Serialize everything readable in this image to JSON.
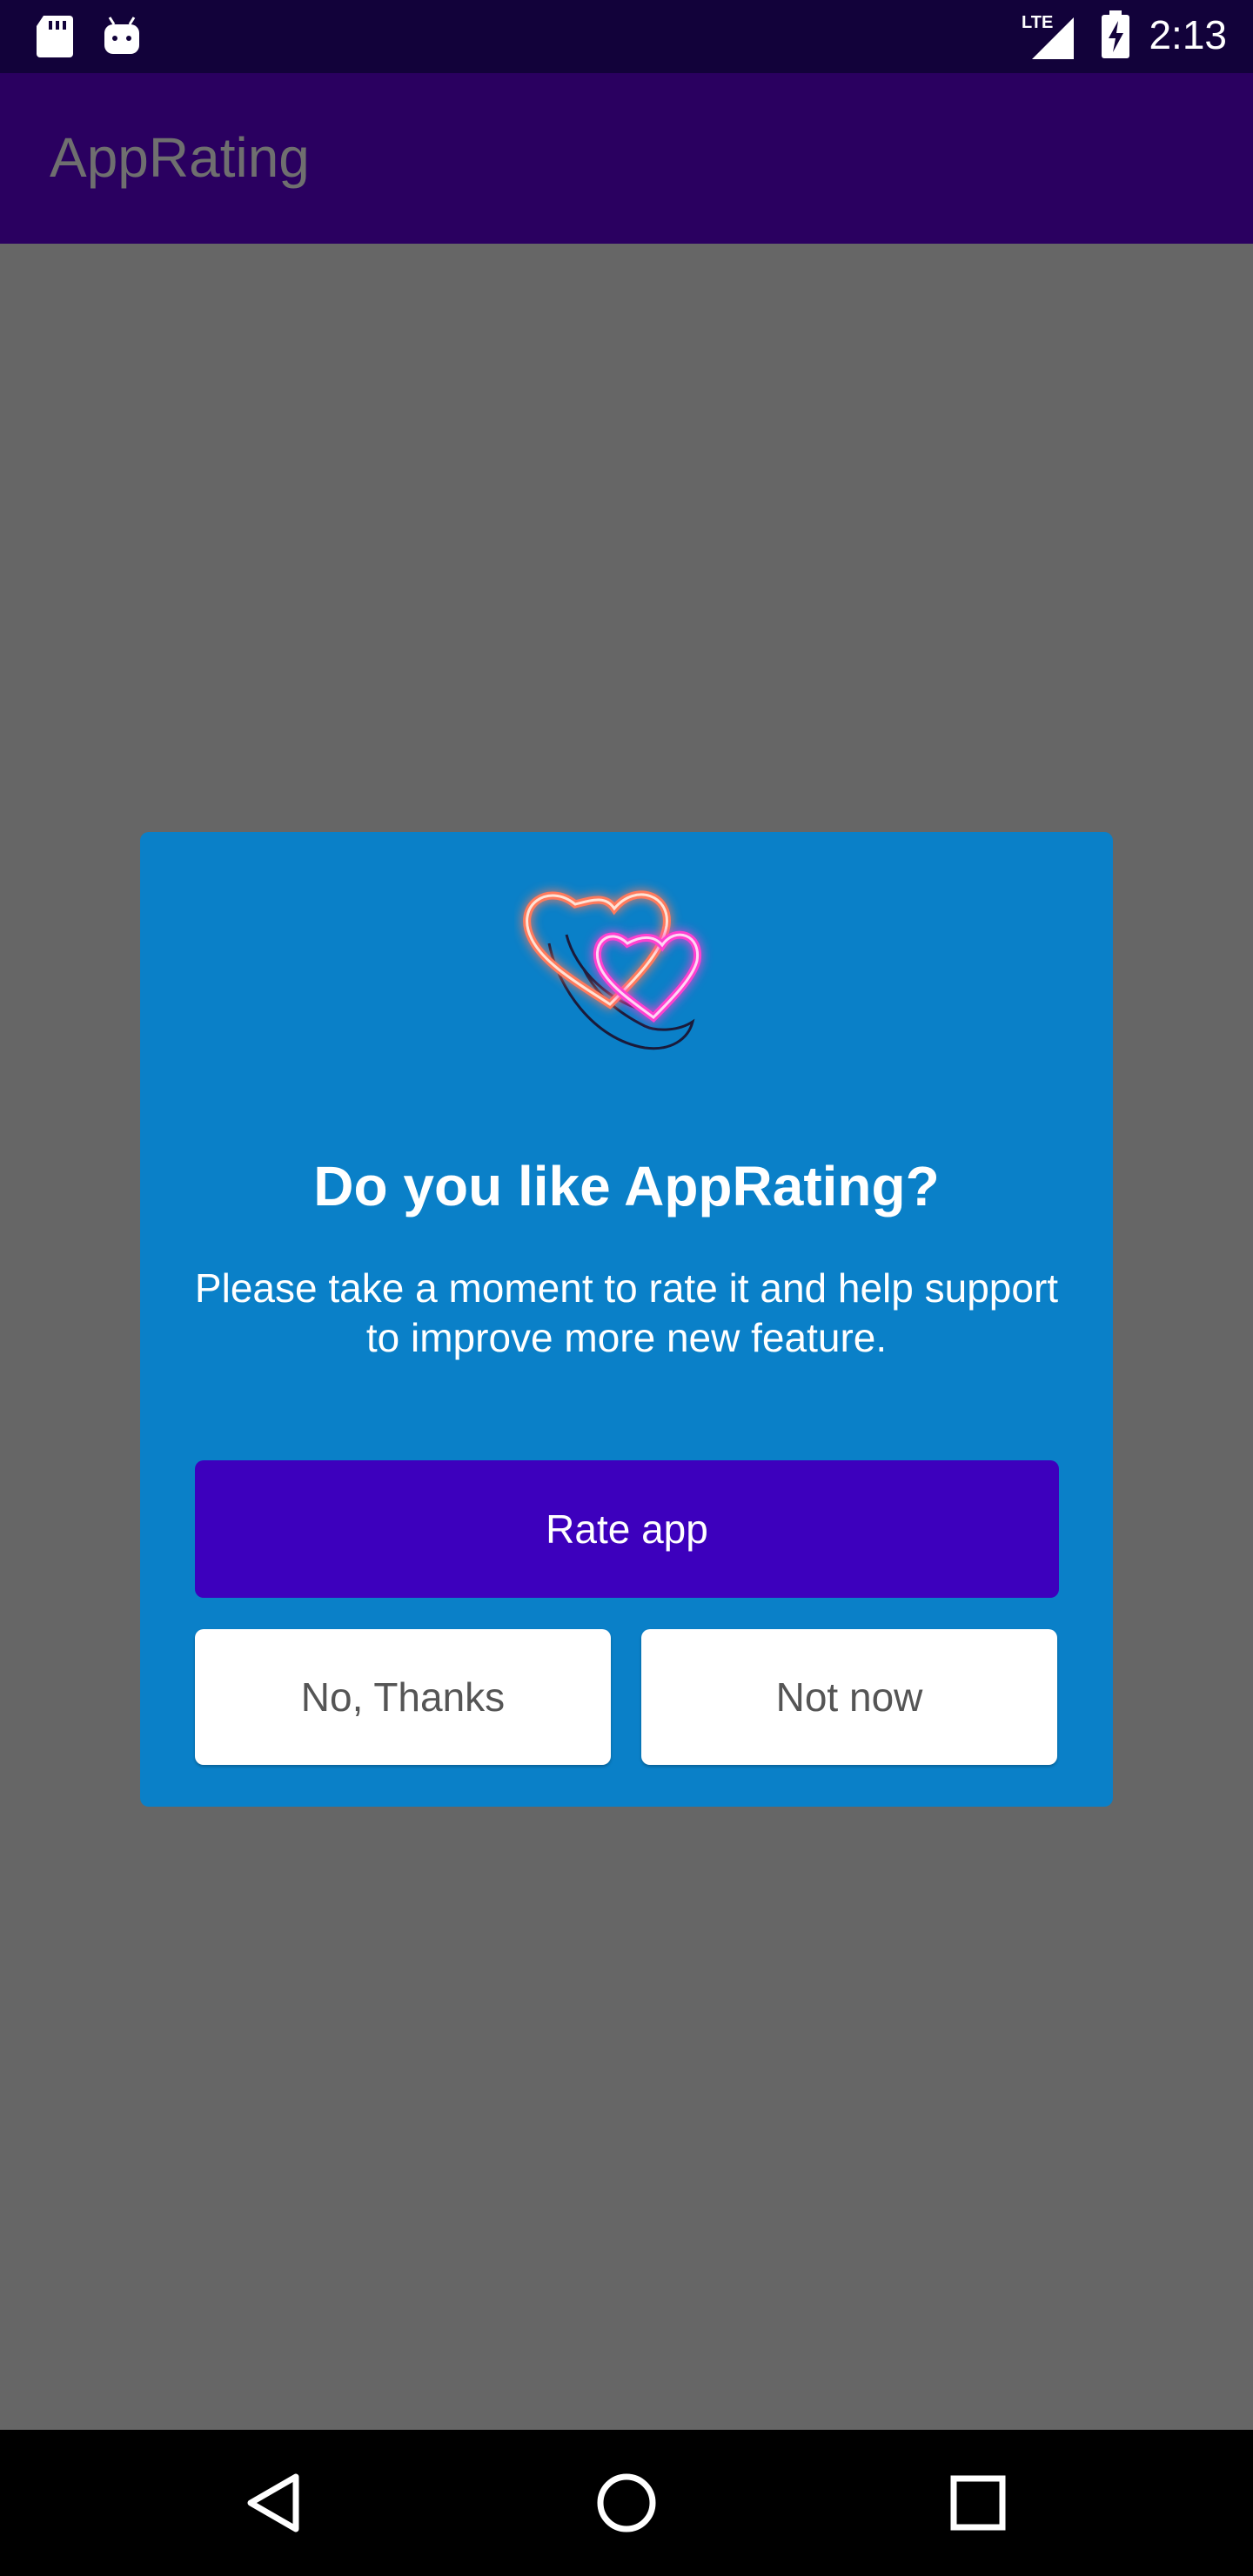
{
  "status_bar": {
    "time": "2:13",
    "network_label": "LTE",
    "icons": [
      "sd-card-icon",
      "android-icon",
      "signal-icon",
      "battery-charging-icon"
    ]
  },
  "app_bar": {
    "title": "AppRating"
  },
  "dialog": {
    "icon": "neon-hearts-icon",
    "title": "Do you like AppRating?",
    "message": "Please take a moment to rate it and help support to improve more new feature.",
    "primary_button": "Rate app",
    "secondary_button_left": "No, Thanks",
    "secondary_button_right": "Not now"
  },
  "nav_bar": {
    "icons": [
      "back-icon",
      "home-icon",
      "recents-icon"
    ]
  },
  "colors": {
    "status_bar": "#12023a",
    "app_bar": "#2a0060",
    "background": "#666666",
    "dialog": "#0a80c8",
    "primary_button": "#3d00bd",
    "secondary_button": "#ffffff"
  }
}
